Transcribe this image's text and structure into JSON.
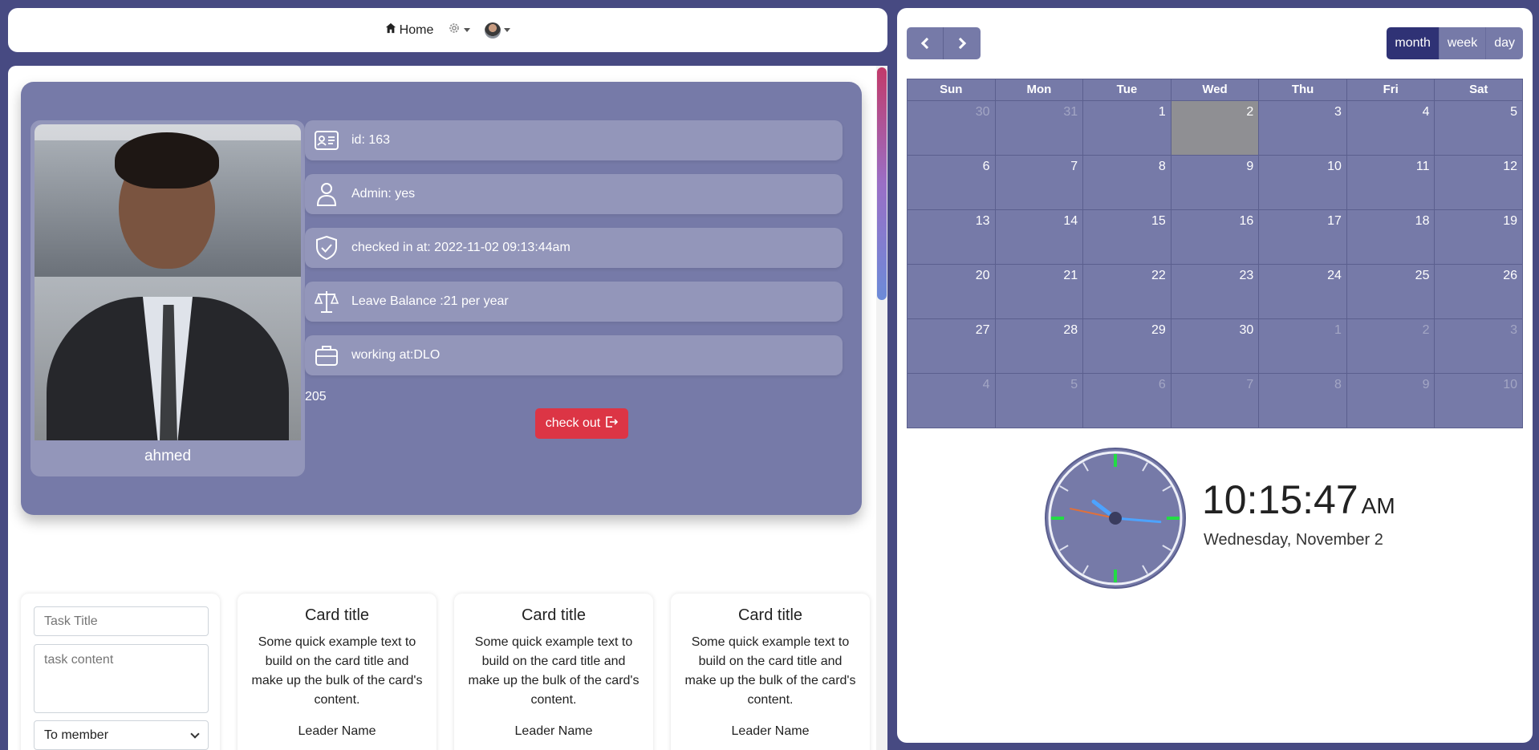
{
  "nav": {
    "home_label": "Home",
    "settings_icon": "gear-icon",
    "home_icon": "house-icon"
  },
  "profile": {
    "name": "ahmed",
    "rows": [
      {
        "icon": "id-card-icon",
        "text": "id: 163"
      },
      {
        "icon": "person-icon",
        "text": "Admin: yes"
      },
      {
        "icon": "shield-check-icon",
        "text": "checked in at: 2022-11-02 09:13:44am"
      },
      {
        "icon": "scale-icon",
        "text": "Leave Balance :21 per year"
      },
      {
        "icon": "briefcase-icon",
        "text": "working at:DLO"
      }
    ],
    "count": "205",
    "checkout_label": "check out"
  },
  "task_form": {
    "title_placeholder": "Task Title",
    "content_placeholder": "task content",
    "member_select": "To member"
  },
  "cards": [
    {
      "title": "Card title",
      "text": "Some quick example text to build on the card title and make up the bulk of the card's content.",
      "leader": "Leader Name"
    },
    {
      "title": "Card title",
      "text": "Some quick example text to build on the card title and make up the bulk of the card's content.",
      "leader": "Leader Name"
    },
    {
      "title": "Card title",
      "text": "Some quick example text to build on the card title and make up the bulk of the card's content.",
      "leader": "Leader Name"
    }
  ],
  "calendar": {
    "views": [
      "month",
      "week",
      "day"
    ],
    "active_view": "month",
    "weekdays": [
      "Sun",
      "Mon",
      "Tue",
      "Wed",
      "Thu",
      "Fri",
      "Sat"
    ],
    "weeks": [
      [
        {
          "d": "30",
          "o": true
        },
        {
          "d": "31",
          "o": true
        },
        {
          "d": "1"
        },
        {
          "d": "2",
          "t": true
        },
        {
          "d": "3"
        },
        {
          "d": "4"
        },
        {
          "d": "5"
        }
      ],
      [
        {
          "d": "6"
        },
        {
          "d": "7"
        },
        {
          "d": "8"
        },
        {
          "d": "9"
        },
        {
          "d": "10"
        },
        {
          "d": "11"
        },
        {
          "d": "12"
        }
      ],
      [
        {
          "d": "13"
        },
        {
          "d": "14"
        },
        {
          "d": "15"
        },
        {
          "d": "16"
        },
        {
          "d": "17"
        },
        {
          "d": "18"
        },
        {
          "d": "19"
        }
      ],
      [
        {
          "d": "20"
        },
        {
          "d": "21"
        },
        {
          "d": "22"
        },
        {
          "d": "23"
        },
        {
          "d": "24"
        },
        {
          "d": "25"
        },
        {
          "d": "26"
        }
      ],
      [
        {
          "d": "27"
        },
        {
          "d": "28"
        },
        {
          "d": "29"
        },
        {
          "d": "30"
        },
        {
          "d": "1",
          "o": true
        },
        {
          "d": "2",
          "o": true
        },
        {
          "d": "3",
          "o": true
        }
      ],
      [
        {
          "d": "4",
          "o": true
        },
        {
          "d": "5",
          "o": true
        },
        {
          "d": "6",
          "o": true
        },
        {
          "d": "7",
          "o": true
        },
        {
          "d": "8",
          "o": true
        },
        {
          "d": "9",
          "o": true
        },
        {
          "d": "10",
          "o": true
        }
      ]
    ]
  },
  "clock": {
    "time": "10:15:47",
    "ampm": "AM",
    "date": "Wednesday, November 2",
    "hours": 10,
    "minutes": 15,
    "seconds": 47
  },
  "colors": {
    "accent": "#767aa8",
    "danger": "#dc3545",
    "clock_marker": "#22dd44",
    "minute_hand": "#4da3ff",
    "second_hand": "#e0703a"
  }
}
